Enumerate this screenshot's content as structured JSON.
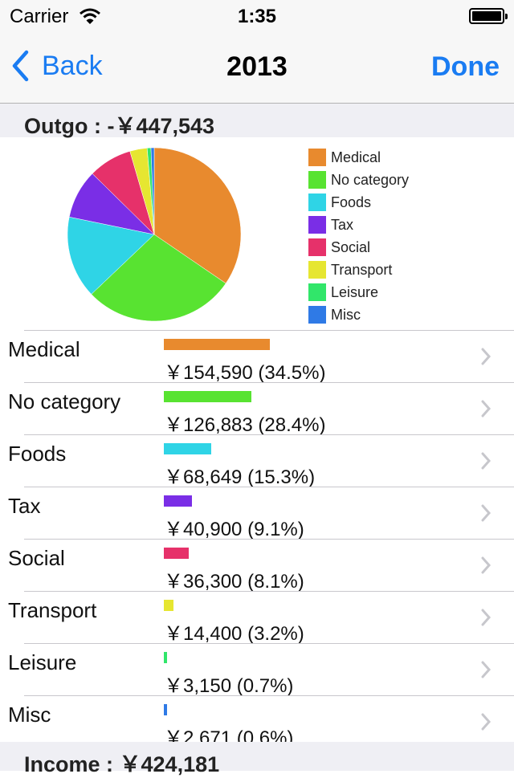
{
  "status_bar": {
    "carrier": "Carrier",
    "time": "1:35"
  },
  "nav": {
    "back_label": "Back",
    "title": "2013",
    "done_label": "Done"
  },
  "outgo": {
    "label": "Outgo : -￥447,543"
  },
  "income": {
    "label": "Income : ￥424,181"
  },
  "chart_data": {
    "type": "pie",
    "categories": [
      "Medical",
      "No category",
      "Foods",
      "Tax",
      "Social",
      "Transport",
      "Leisure",
      "Misc"
    ],
    "values": [
      154590,
      126883,
      68649,
      40900,
      36300,
      14400,
      3150,
      2671
    ],
    "colors": [
      "#e88a2e",
      "#58e331",
      "#2fd4e6",
      "#7a2ee6",
      "#e6316a",
      "#e6e631",
      "#31e66a",
      "#2f7ae6"
    ],
    "legend_position": "right"
  },
  "rows": [
    {
      "name": "Medical",
      "amount": "￥154,590 (34.5%)",
      "share": 0.345
    },
    {
      "name": "No category",
      "amount": "￥126,883 (28.4%)",
      "share": 0.284
    },
    {
      "name": "Foods",
      "amount": "￥68,649 (15.3%)",
      "share": 0.153
    },
    {
      "name": "Tax",
      "amount": "￥40,900 (9.1%)",
      "share": 0.091
    },
    {
      "name": "Social",
      "amount": "￥36,300 (8.1%)",
      "share": 0.081
    },
    {
      "name": "Transport",
      "amount": "￥14,400 (3.2%)",
      "share": 0.032
    },
    {
      "name": "Leisure",
      "amount": "￥3,150 (0.7%)",
      "share": 0.007
    },
    {
      "name": "Misc",
      "amount": "￥2,671 (0.6%)",
      "share": 0.006
    }
  ]
}
